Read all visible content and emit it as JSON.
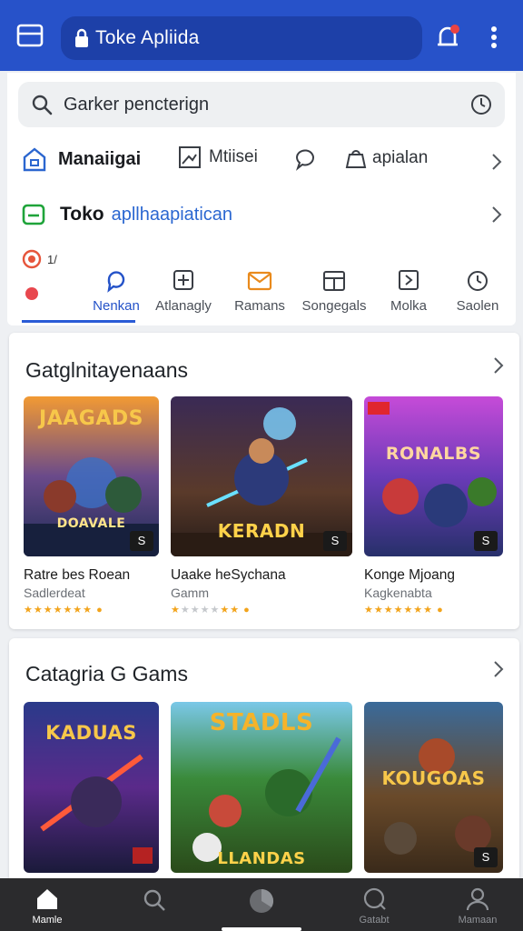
{
  "appbar": {
    "url_text": "Toke Apliida",
    "accent": "#2752c9",
    "icons": [
      "menu-icon",
      "lock-icon",
      "notification-icon",
      "more-vert-icon"
    ]
  },
  "search": {
    "placeholder": "Garker pencterign",
    "icons": [
      "search-icon",
      "timer-icon"
    ]
  },
  "quick_links": [
    {
      "label": "Manaiigai",
      "icon": "house-icon"
    },
    {
      "label": "Mtiisei",
      "icon": "picture-icon"
    },
    {
      "label": "",
      "icon": "chat-icon"
    },
    {
      "label": "apialan",
      "icon": "bag-icon"
    }
  ],
  "toko_row": {
    "label": "Toko",
    "link_text": "apllhaapiatican"
  },
  "mini_status": {
    "text": "1/"
  },
  "categories": [
    {
      "label": "",
      "icon": "dot-icon"
    },
    {
      "label": "Nenkan",
      "icon": "chat-bubble-icon",
      "active": true
    },
    {
      "label": "Atlanagly",
      "icon": "plus-box-icon"
    },
    {
      "label": "Ramans",
      "icon": "mail-icon"
    },
    {
      "label": "Songegals",
      "icon": "calendar-icon"
    },
    {
      "label": "Molka",
      "icon": "arrow-box-icon"
    },
    {
      "label": "Saolen",
      "icon": "clock-icon"
    }
  ],
  "section1": {
    "title": "Gatglnitayenaans",
    "games": [
      {
        "name": "Ratre bes Roean",
        "sub": "Sadlerdeat",
        "art_title": "JAAGADS",
        "art_sub": "DOAVALE",
        "badge": "S",
        "rating": 5
      },
      {
        "name": "Uaake heSychana",
        "sub": "Gamm",
        "art_title": "KERADN",
        "art_sub": "",
        "badge": "S",
        "rating": 3
      },
      {
        "name": "Konge Mjoang",
        "sub": "Kagkenabta",
        "art_title": "RONALBS",
        "art_sub": "",
        "badge": "S",
        "rating": 5
      }
    ]
  },
  "section2": {
    "title": "Catagria G Gams",
    "games": [
      {
        "art_title": "KADUAS",
        "badge": ""
      },
      {
        "art_title": "STADLS",
        "art_sub": "LLANDAS",
        "badge": ""
      },
      {
        "art_title": "KOUGOAS",
        "badge": "S"
      }
    ]
  },
  "bottom_nav": [
    {
      "label": "Mamle",
      "icon": "home-icon",
      "active": true
    },
    {
      "label": "",
      "icon": "search-icon"
    },
    {
      "label": "",
      "icon": "circle-icon"
    },
    {
      "label": "Gatabt",
      "icon": "globe-icon"
    },
    {
      "label": "Mamaan",
      "icon": "person-icon"
    }
  ]
}
